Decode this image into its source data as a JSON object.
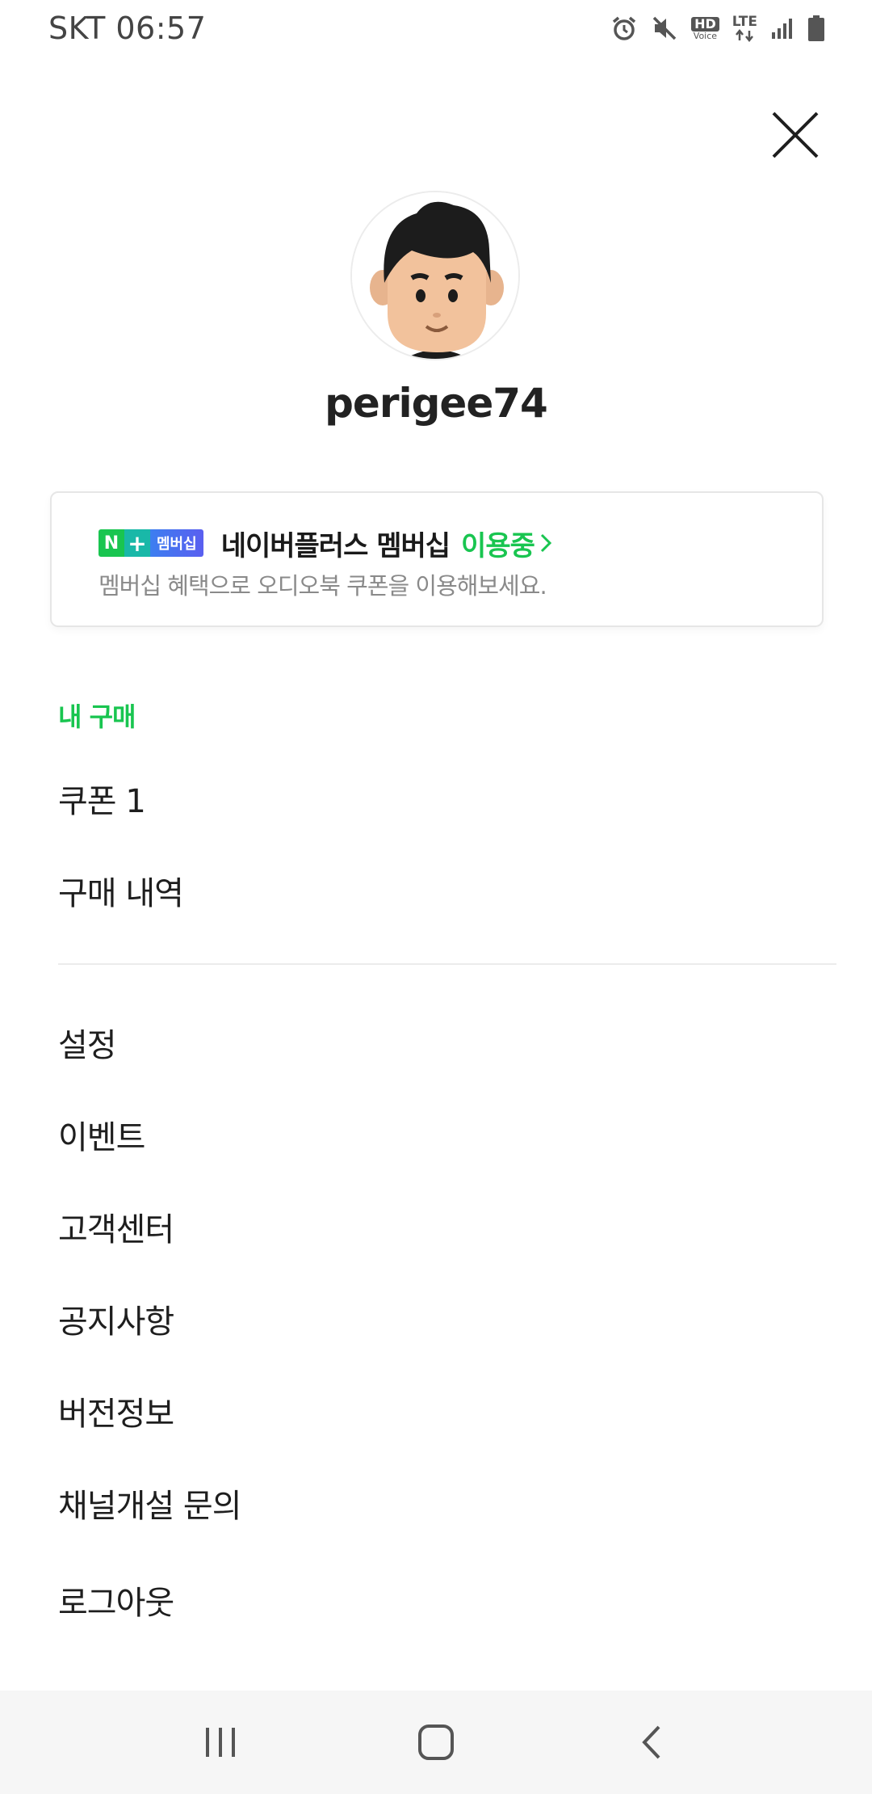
{
  "status_bar": {
    "carrier_time": "SKT 06:57",
    "icons": [
      "alarm-icon",
      "mute-icon",
      "hd-voice-icon",
      "lte-icon",
      "signal-icon",
      "battery-icon"
    ],
    "hd_label": "HD",
    "voice_label": "Voice",
    "lte_label": "LTE"
  },
  "profile": {
    "username": "perigee74",
    "avatar_icon": "avatar-character"
  },
  "membership": {
    "badge_n": "N",
    "badge_plus": "+",
    "badge_label": "멤버십",
    "title": "네이버플러스 멤버십",
    "status": "이용중",
    "subtitle": "멤버십 혜택으로 오디오북 쿠폰을 이용해보세요.",
    "accent_color": "#19c550"
  },
  "purchases": {
    "section_label": "내 구매",
    "items": [
      {
        "label": "쿠폰 1"
      },
      {
        "label": "구매 내역"
      }
    ]
  },
  "menu": {
    "items": [
      {
        "label": "설정"
      },
      {
        "label": "이벤트"
      },
      {
        "label": "고객센터"
      },
      {
        "label": "공지사항"
      },
      {
        "label": "버전정보"
      },
      {
        "label": "채널개설 문의"
      },
      {
        "label": "로그아웃"
      }
    ]
  },
  "nav_bar": {
    "icons": [
      "recent-apps-icon",
      "home-icon",
      "back-icon"
    ]
  }
}
